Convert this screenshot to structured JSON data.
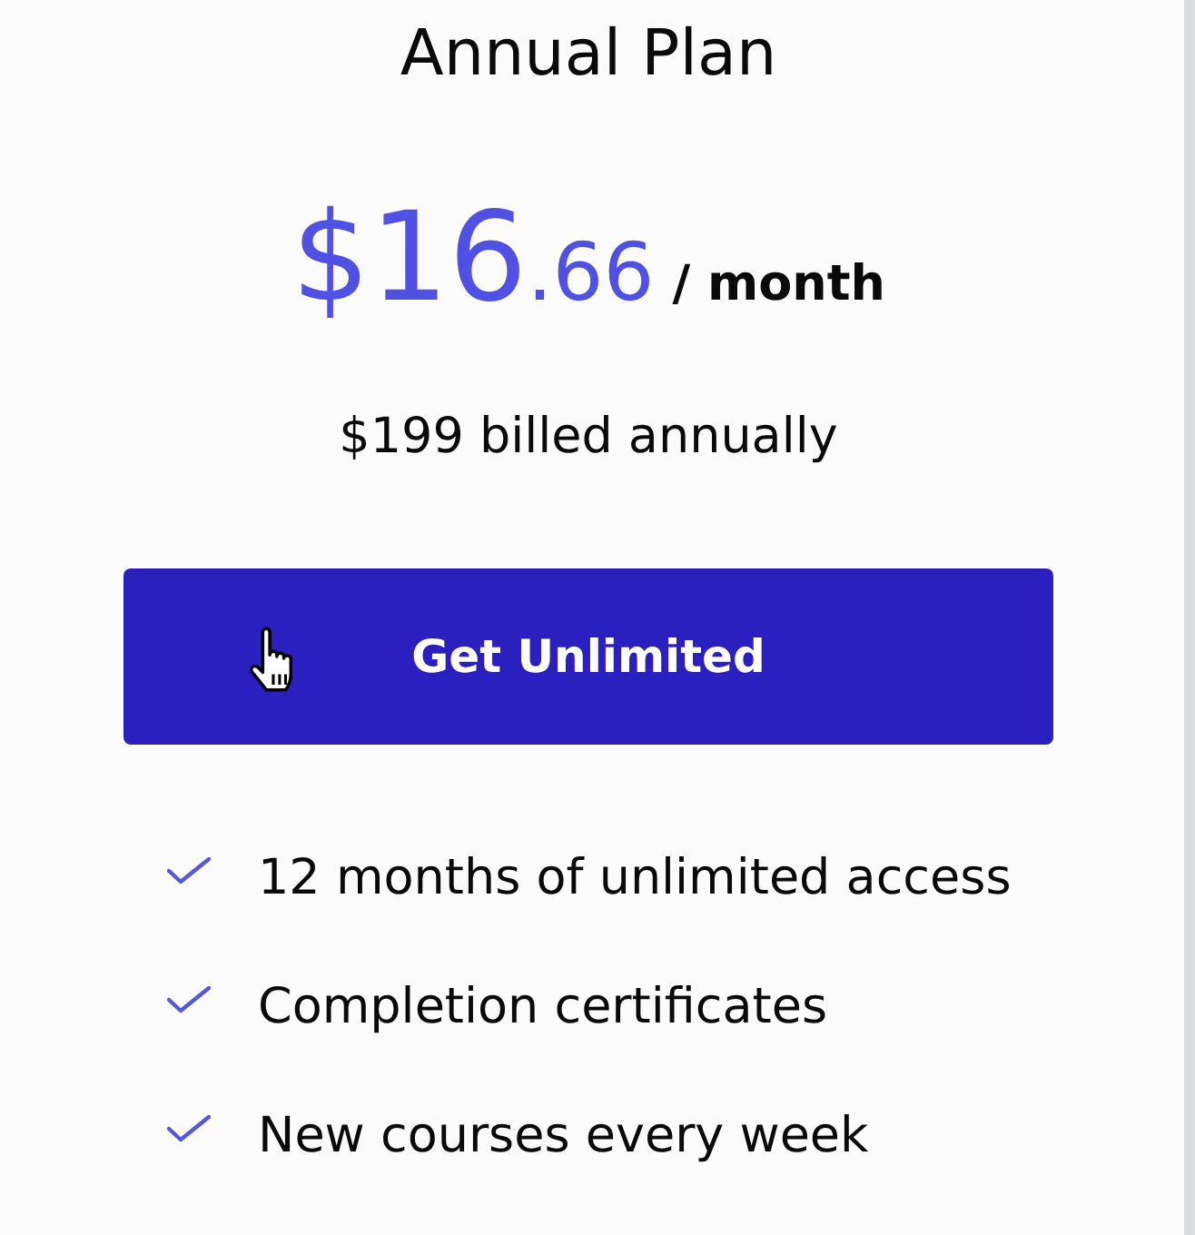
{
  "plan": {
    "title": "Annual Plan"
  },
  "price": {
    "amount": "$16",
    "cents": ".66",
    "period": "/ month"
  },
  "billing_note": "$199 billed annually",
  "cta_button": {
    "label": "Get Unlimited"
  },
  "features": [
    {
      "text": "12 months of unlimited access"
    },
    {
      "text": "Completion certificates"
    },
    {
      "text": "New courses every week"
    }
  ]
}
